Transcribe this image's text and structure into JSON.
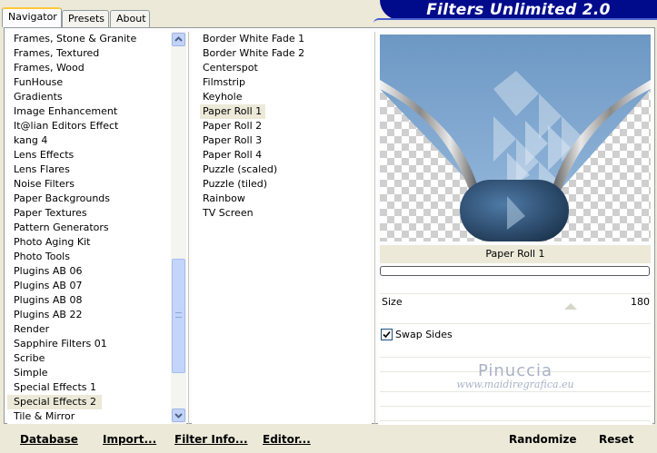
{
  "tabs": [
    {
      "label": "Navigator",
      "active": true
    },
    {
      "label": "Presets",
      "active": false
    },
    {
      "label": "About",
      "active": false
    }
  ],
  "banner_title": "Filters Unlimited 2.0",
  "categories": [
    "Frames, Stone & Granite",
    "Frames, Textured",
    "Frames, Wood",
    "FunHouse",
    "Gradients",
    "Image Enhancement",
    "It@lian Editors Effect",
    "kang 4",
    "Lens Effects",
    "Lens Flares",
    "Noise Filters",
    "Paper Backgrounds",
    "Paper Textures",
    "Pattern Generators",
    "Photo Aging Kit",
    "Photo Tools",
    "Plugins AB 06",
    "Plugins AB 07",
    "Plugins AB 08",
    "Plugins AB 22",
    "Render",
    "Sapphire Filters 01",
    "Scribe",
    "Simple",
    "Special Effects 1",
    "Special Effects 2",
    "Tile & Mirror"
  ],
  "selected_category": "Special Effects 2",
  "filters": [
    "Border White Fade 1",
    "Border White Fade 2",
    "Centerspot",
    "Filmstrip",
    "Keyhole",
    "Paper Roll 1",
    "Paper Roll 2",
    "Paper Roll 3",
    "Paper Roll 4",
    "Puzzle (scaled)",
    "Puzzle (tiled)",
    "Rainbow",
    "TV Screen"
  ],
  "selected_filter": "Paper Roll 1",
  "preview": {
    "title": "Paper Roll 1",
    "icon": "paper-roll-preview-image"
  },
  "params": {
    "size_label": "Size",
    "size_value": "180",
    "swap_sides_label": "Swap Sides",
    "swap_sides_checked": true
  },
  "watermark": {
    "name": "Pinuccia",
    "url": "www.maidiregrafica.eu"
  },
  "buttons": {
    "database": "Database",
    "import": "Import...",
    "filter_info": "Filter Info...",
    "editor": "Editor...",
    "randomize": "Randomize",
    "reset": "Reset"
  },
  "colors": {
    "banner": "#000b8c",
    "panel_bg": "#ece9d8",
    "scrollbar": "#c1d3fb"
  }
}
